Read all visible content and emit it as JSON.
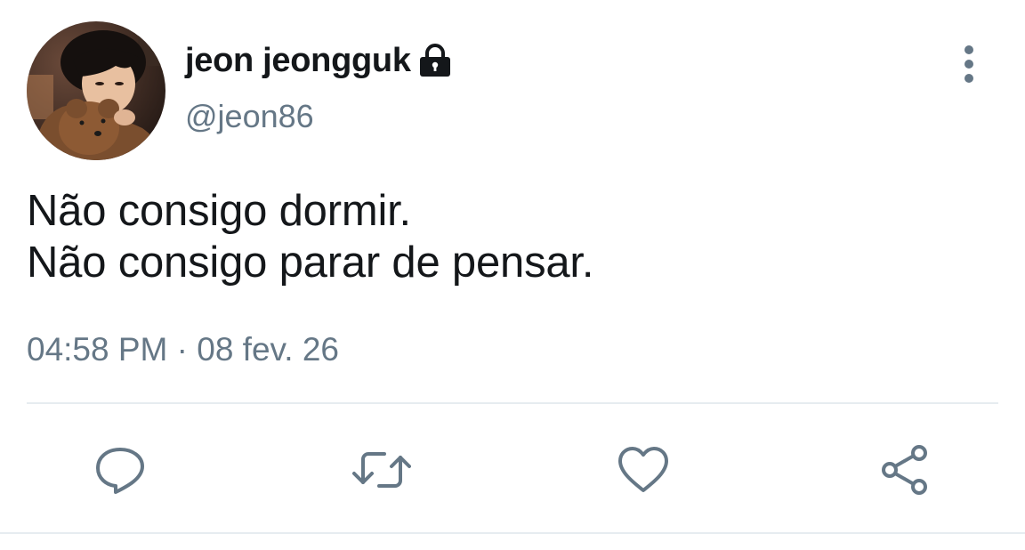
{
  "user": {
    "display_name": "jeon jeongguk",
    "handle": "@jeon86",
    "protected": true,
    "avatar_alt": "profile photo"
  },
  "tweet": {
    "lines": [
      "Não consigo dormir.",
      "Não consigo parar de pensar."
    ],
    "timestamp": "04:58 PM · 08 fev. 26"
  },
  "actions": [
    {
      "name": "reply",
      "icon": "reply-icon"
    },
    {
      "name": "retweet",
      "icon": "retweet-icon"
    },
    {
      "name": "like",
      "icon": "heart-icon"
    },
    {
      "name": "share",
      "icon": "share-icon"
    }
  ],
  "colors": {
    "text_primary": "#14171a",
    "text_secondary": "#657786",
    "divider": "#e6ecf0",
    "background": "#ffffff"
  }
}
